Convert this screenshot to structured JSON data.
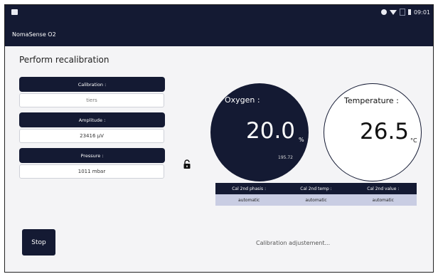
{
  "statusbar": {
    "time": "09:01"
  },
  "app": {
    "title": "NomaSense O2"
  },
  "page": {
    "title": "Perform recalibration"
  },
  "fields": [
    {
      "label": "Calibration :",
      "value": "tiers"
    },
    {
      "label": "Amplitude :",
      "value": "23416 µV"
    },
    {
      "label": "Pressure :",
      "value": "1011 mbar"
    }
  ],
  "oxygen": {
    "label": "Oxygen :",
    "value": "20.0",
    "unit": "%",
    "raw": "195.72"
  },
  "temperature": {
    "label": "Temperature :",
    "value": "26.5",
    "unit": "°C"
  },
  "calibration_table": {
    "headers": [
      "Cal 2nd phasis :",
      "Cal 2nd temp :",
      "Cal 2nd value :"
    ],
    "values": [
      "automatic",
      "automatic",
      "automatic"
    ]
  },
  "actions": {
    "stop_label": "Stop"
  },
  "status": {
    "message": "Calibration adjustement..."
  },
  "colors": {
    "primary": "#141a33",
    "accent_row": "#c9cde3",
    "background": "#f4f4f6"
  }
}
